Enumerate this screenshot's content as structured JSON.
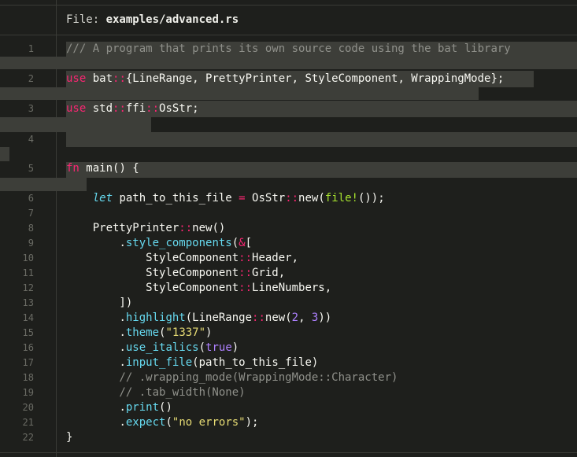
{
  "header": {
    "file_label": "File: ",
    "file_name": "examples/advanced.rs"
  },
  "lines": [
    {
      "n": "1",
      "text": "/// A program that prints its own source code using the bat library"
    },
    {
      "n": "2",
      "text": "use bat::{LineRange, PrettyPrinter, StyleComponent, WrappingMode};"
    },
    {
      "n": "3",
      "text": "use std::ffi::OsStr;"
    },
    {
      "n": "4",
      "text": ""
    },
    {
      "n": "5",
      "text": "fn main() {"
    },
    {
      "n": "6",
      "text": "    let path_to_this_file = OsStr::new(file!());"
    },
    {
      "n": "7",
      "text": ""
    },
    {
      "n": "8",
      "text": "    PrettyPrinter::new()"
    },
    {
      "n": "9",
      "text": "        .style_components(&["
    },
    {
      "n": "10",
      "text": "            StyleComponent::Header,"
    },
    {
      "n": "11",
      "text": "            StyleComponent::Grid,"
    },
    {
      "n": "12",
      "text": "            StyleComponent::LineNumbers,"
    },
    {
      "n": "13",
      "text": "        ])"
    },
    {
      "n": "14",
      "text": "        .highlight(LineRange::new(2, 3))"
    },
    {
      "n": "15",
      "text": "        .theme(\"1337\")"
    },
    {
      "n": "16",
      "text": "        .use_italics(true)"
    },
    {
      "n": "17",
      "text": "        .input_file(path_to_this_file)"
    },
    {
      "n": "18",
      "text": "        // .wrapping_mode(WrappingMode::Character)"
    },
    {
      "n": "19",
      "text": "        // .tab_width(None)"
    },
    {
      "n": "20",
      "text": "        .print()"
    },
    {
      "n": "21",
      "text": "        .expect(\"no errors\");"
    },
    {
      "n": "22",
      "text": "}"
    }
  ],
  "colors": {
    "background": "#1e1f1c",
    "highlight": "#3d3e39",
    "keyword": "#f92672",
    "string": "#e6db74"
  }
}
